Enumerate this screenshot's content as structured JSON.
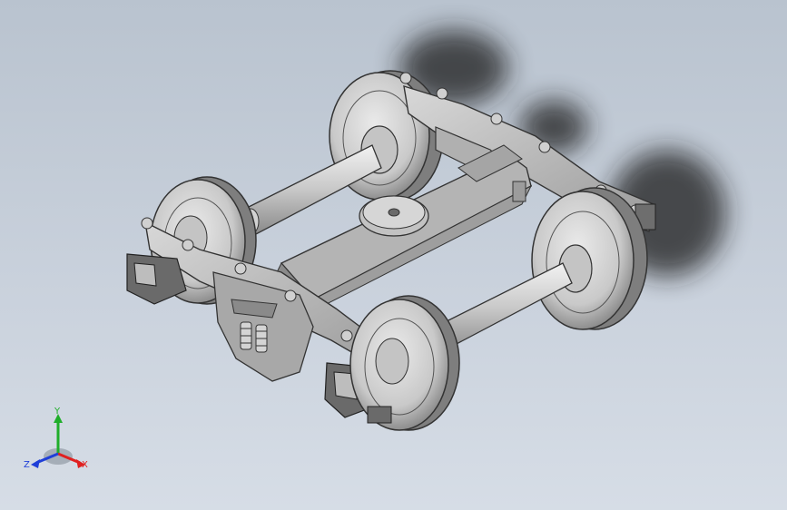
{
  "viewport": {
    "background_top": "#b9c3cf",
    "background_bottom": "#d6dde6"
  },
  "model": {
    "body_color": "#b4b4b4",
    "shadow_color": "#1a1a1a"
  },
  "triad": {
    "x_label": "X",
    "y_label": "Y",
    "z_label": "Z",
    "x_color": "#e02020",
    "y_color": "#1fae2a",
    "z_color": "#1f3fd8"
  }
}
